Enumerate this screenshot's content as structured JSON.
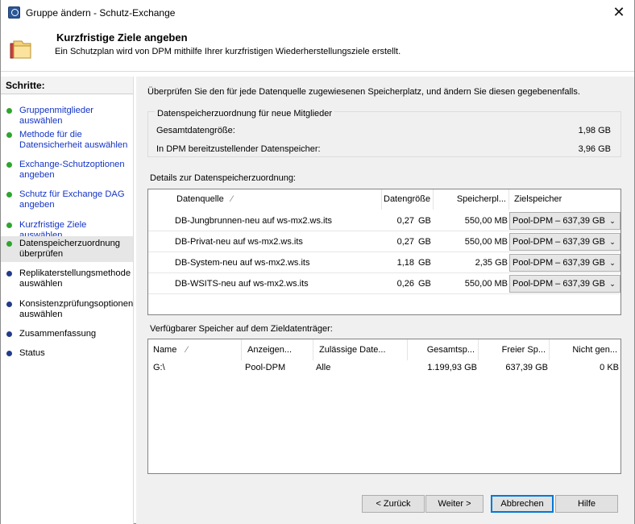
{
  "window": {
    "title": "Gruppe ändern - Schutz-Exchange",
    "close_symbol": "✕"
  },
  "header": {
    "title": "Kurzfristige Ziele angeben",
    "description": "Ein Schutzplan wird von DPM mithilfe Ihrer kurzfristigen Wiederherstellungsziele erstellt.",
    "icon": "folder-icon"
  },
  "steps": {
    "title": "Schritte:",
    "items": [
      {
        "label": "Gruppenmitglieder auswählen",
        "state": "done"
      },
      {
        "label": "Methode für die Datensicherheit auswählen",
        "state": "done"
      },
      {
        "label": "Exchange-Schutzoptionen angeben",
        "state": "done"
      },
      {
        "label": "Schutz für Exchange DAG angeben",
        "state": "done"
      },
      {
        "label": "Kurzfristige Ziele auswählen",
        "state": "done"
      },
      {
        "label": "Datenspeicherzuordnung überprüfen",
        "state": "current"
      },
      {
        "label": "Replikaterstellungsmethode auswählen",
        "state": "todo"
      },
      {
        "label": "Konsistenzprüfungsoptionen auswählen",
        "state": "todo"
      },
      {
        "label": "Zusammenfassung",
        "state": "todo"
      },
      {
        "label": "Status",
        "state": "todo"
      }
    ]
  },
  "content": {
    "intro": "Überprüfen Sie den für jede Datenquelle zugewiesenen Speicherplatz, und ändern Sie diesen gegebenenfalls.",
    "allocation": {
      "title": "Datenspeicherzuordnung für neue Mitglieder",
      "total_label": "Gesamtdatengröße:",
      "total_value": "1,98 GB",
      "dpm_label": "In DPM bereitzustellender Datenspeicher:",
      "dpm_value": "3,96 GB"
    },
    "details_label": "Details zur Datenspeicherzuordnung:",
    "details_columns": {
      "source": "Datenquelle",
      "sort": "⁄",
      "size": "Datengröße",
      "storage": "Speicherpl...",
      "target": "Zielspeicher"
    },
    "details_rows": [
      {
        "source": "DB-Jungbrunnen-neu auf ws-mx2.ws.its",
        "size": "0,27",
        "unit": "GB",
        "storage": "550,00 MB",
        "target": "Pool-DPM – 637,39 GB"
      },
      {
        "source": "DB-Privat-neu auf ws-mx2.ws.its",
        "size": "0,27",
        "unit": "GB",
        "storage": "550,00 MB",
        "target": "Pool-DPM – 637,39 GB"
      },
      {
        "source": "DB-System-neu auf ws-mx2.ws.its",
        "size": "1,18",
        "unit": "GB",
        "storage": "2,35 GB",
        "target": "Pool-DPM – 637,39 GB"
      },
      {
        "source": "DB-WSITS-neu auf ws-mx2.ws.its",
        "size": "0,26",
        "unit": "GB",
        "storage": "550,00 MB",
        "target": "Pool-DPM – 637,39 GB"
      }
    ],
    "storage_label": "Verfügbarer Speicher auf dem Zieldatenträger:",
    "storage_columns": {
      "name": "Name",
      "sort": "⁄",
      "display": "Anzeigen...",
      "allowed": "Zulässige Date...",
      "total": "Gesamtsp...",
      "free": "Freier Sp...",
      "unalloc": "Nicht gen..."
    },
    "storage_rows": [
      {
        "name": "G:\\",
        "display": "Pool-DPM",
        "allowed": "Alle",
        "total": "1.199,93 GB",
        "free": "637,39 GB",
        "unalloc": "0 KB"
      }
    ]
  },
  "footer": {
    "back": "< Zurück",
    "next": "Weiter >",
    "cancel": "Abbrechen",
    "help": "Hilfe"
  }
}
